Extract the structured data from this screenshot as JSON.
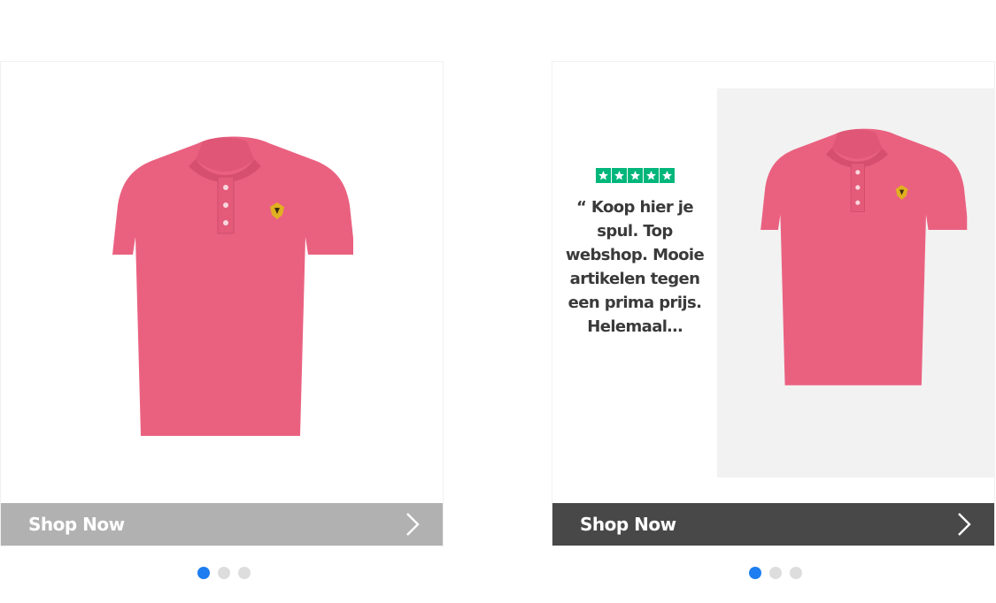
{
  "cards": [
    {
      "shop_label": "Shop Now",
      "colors": {
        "bar": "#b1b1b1"
      },
      "product_icon": "pink-polo-shirt",
      "carousel": {
        "count": 3,
        "active": 1
      }
    },
    {
      "shop_label": "Shop Now",
      "colors": {
        "bar": "#484848"
      },
      "review": {
        "rating": 5,
        "star_color": "#00b67a",
        "quote": "“ Koop hier je spul. Top webshop. Mooie artikelen tegen een prima prijs. Helemaal…"
      },
      "product_icon": "pink-polo-shirt",
      "carousel": {
        "count": 3,
        "active": 1
      }
    }
  ],
  "colors": {
    "shirt": "#ea6180",
    "dot_active": "#1e7df0",
    "dot_inactive": "#dddddd"
  }
}
